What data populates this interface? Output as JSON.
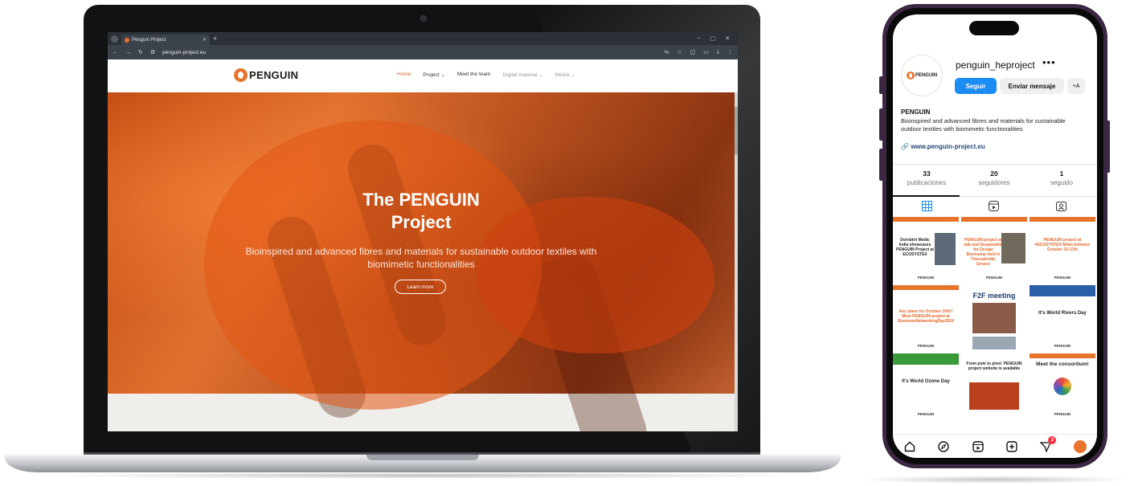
{
  "browser": {
    "tab_title": "Penguin Project",
    "url": "penguin-project.eu"
  },
  "website": {
    "logo_text": "PENGUIN",
    "nav": [
      "Home",
      "Project",
      "Meet the team",
      "Digital material",
      "Media"
    ],
    "hero_title_line1": "The PENGUIN",
    "hero_title_line2": "Project",
    "hero_subtitle": "Bioinspired and advanced fibres and materials for sustainable outdoor textiles with biomimetic functionalities",
    "cta_label": "Learn more"
  },
  "instagram": {
    "avatar_text": "PENGUIN",
    "username": "penguin_heproject",
    "more": "•••",
    "follow_label": "Seguir",
    "message_label": "Enviar mensaje",
    "add_user_label": "+A",
    "bio_name": "PENGUIN",
    "bio_text": "Bioinspired and advanced fibres and materials for sustainable outdoor textiles with biomimetic functionalities",
    "bio_link": "www.penguin-project.eu",
    "stats": [
      {
        "num": "33",
        "label": "publicaciones"
      },
      {
        "num": "20",
        "label": "seguidores"
      },
      {
        "num": "1",
        "label": "seguido"
      }
    ],
    "posts": [
      {
        "title": "Dornbirn Medic India showcases PENGUIN Project at ECOSYSTEX",
        "foot": "PENGUIN"
      },
      {
        "title": "PENGUIN project at talk and Sustainable for Design Bootcamp held in Thessaloniki, Greece",
        "foot": "PENGUIN"
      },
      {
        "title": "PENGUIN project at #ECOSYSTEX Milan between October 15-17th",
        "foot": "PENGUIN"
      },
      {
        "title": "Any plans for October 10th? Meet PENGUIN project at BusinessNetworkingDay2024",
        "foot": "PENGUIN"
      },
      {
        "title": "F2F meeting",
        "foot": ""
      },
      {
        "title": "It's World Rivers Day",
        "foot": "PENGUIN"
      },
      {
        "title": "It's World Ozone Day",
        "foot": "PENGUIN"
      },
      {
        "title": "From pole to pixel: PENGUIN project website is available",
        "foot": ""
      },
      {
        "title": "Meet the consortium!",
        "foot": "PENGUIN"
      }
    ],
    "notif_count": "2"
  },
  "colors": {
    "brand_orange": "#e8742c",
    "ig_blue": "#1a8cf2"
  }
}
